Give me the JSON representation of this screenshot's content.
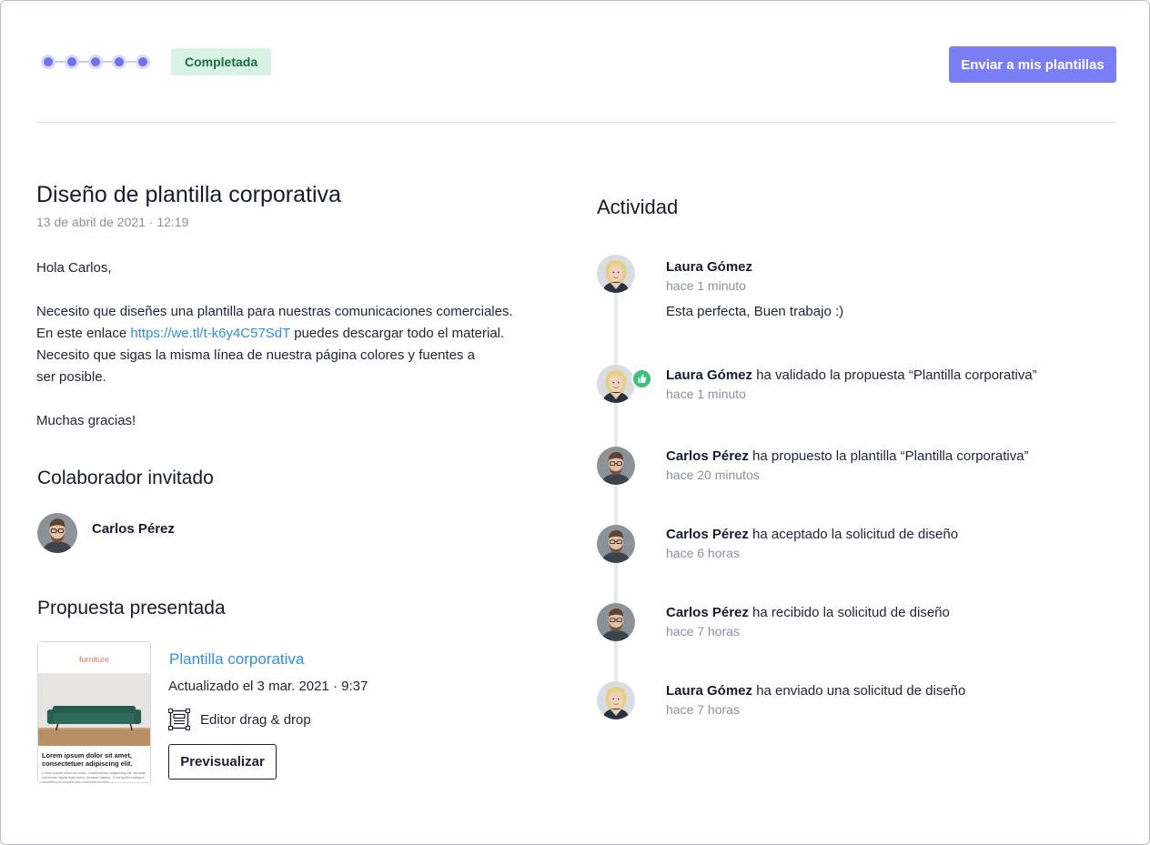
{
  "header": {
    "stepper_steps": 5,
    "status_badge": "Completada",
    "send_button": "Enviar a mis plantillas"
  },
  "request": {
    "title": "Diseño de plantilla corporativa",
    "date": "13 de abril de 2021 · 12:19",
    "greeting": "Hola Carlos,",
    "body_line1": "Necesito que diseñes una plantilla para nuestras comunicaciones comerciales.",
    "body_line2_before": "En este enlace ",
    "link": "https://we.tl/t-k6y4C57SdT",
    "body_line2_after": " puedes descargar todo el material.",
    "body_line3": "Necesito que sigas la misma línea de nuestra página colores y fuentes a ser posible.",
    "closing": "Muchas gracias!"
  },
  "collaborator": {
    "section_title": "Colaborador invitado",
    "name": "Carlos Pérez"
  },
  "proposal": {
    "section_title": "Propuesta presentada",
    "thumbnail_brand": "furniture",
    "thumbnail_heading": "Lorem ipsum dolor sit amet, consectetuer adipiscing elit.",
    "thumbnail_body": "Lorem ipsum dolor sit amet, consectetuer adipiscing elit. Aenean commodo ligula eget dolor. Aenean massa. Cum sociis natoque penatibus et magnis dis parturient montes.",
    "name": "Plantilla corporativa",
    "updated": "Actualizado el 3 mar. 2021 · 9:37",
    "editor": "Editor drag & drop",
    "preview_button": "Previsualizar"
  },
  "activity": {
    "title": "Actividad",
    "items": [
      {
        "author": "Laura Gómez",
        "action": "",
        "time": "hace 1 minuto",
        "comment": "Esta perfecta, Buen trabajo :)"
      },
      {
        "author": "Laura Gómez",
        "action": " ha validado la propuesta “Plantilla corporativa”",
        "time": "hace 1 minuto"
      },
      {
        "author": "Carlos Pérez",
        "action": " ha propuesto la plantilla “Plantilla corporativa”",
        "time": "hace 20 minutos"
      },
      {
        "author": "Carlos Pérez",
        "action": " ha aceptado la solicitud de diseño",
        "time": "hace 6 horas"
      },
      {
        "author": "Carlos Pérez",
        "action": " ha recibido la solicitud de diseño",
        "time": "hace 7 horas"
      },
      {
        "author": "Laura Gómez",
        "action": " ha enviado una solicitud de diseño",
        "time": "hace 7 horas"
      }
    ]
  },
  "colors": {
    "accent": "#7a7ef5",
    "link": "#2f8fe0",
    "badge_bg": "#d8f3e4",
    "badge_text": "#1e6b43",
    "approve": "#3fc07a"
  }
}
